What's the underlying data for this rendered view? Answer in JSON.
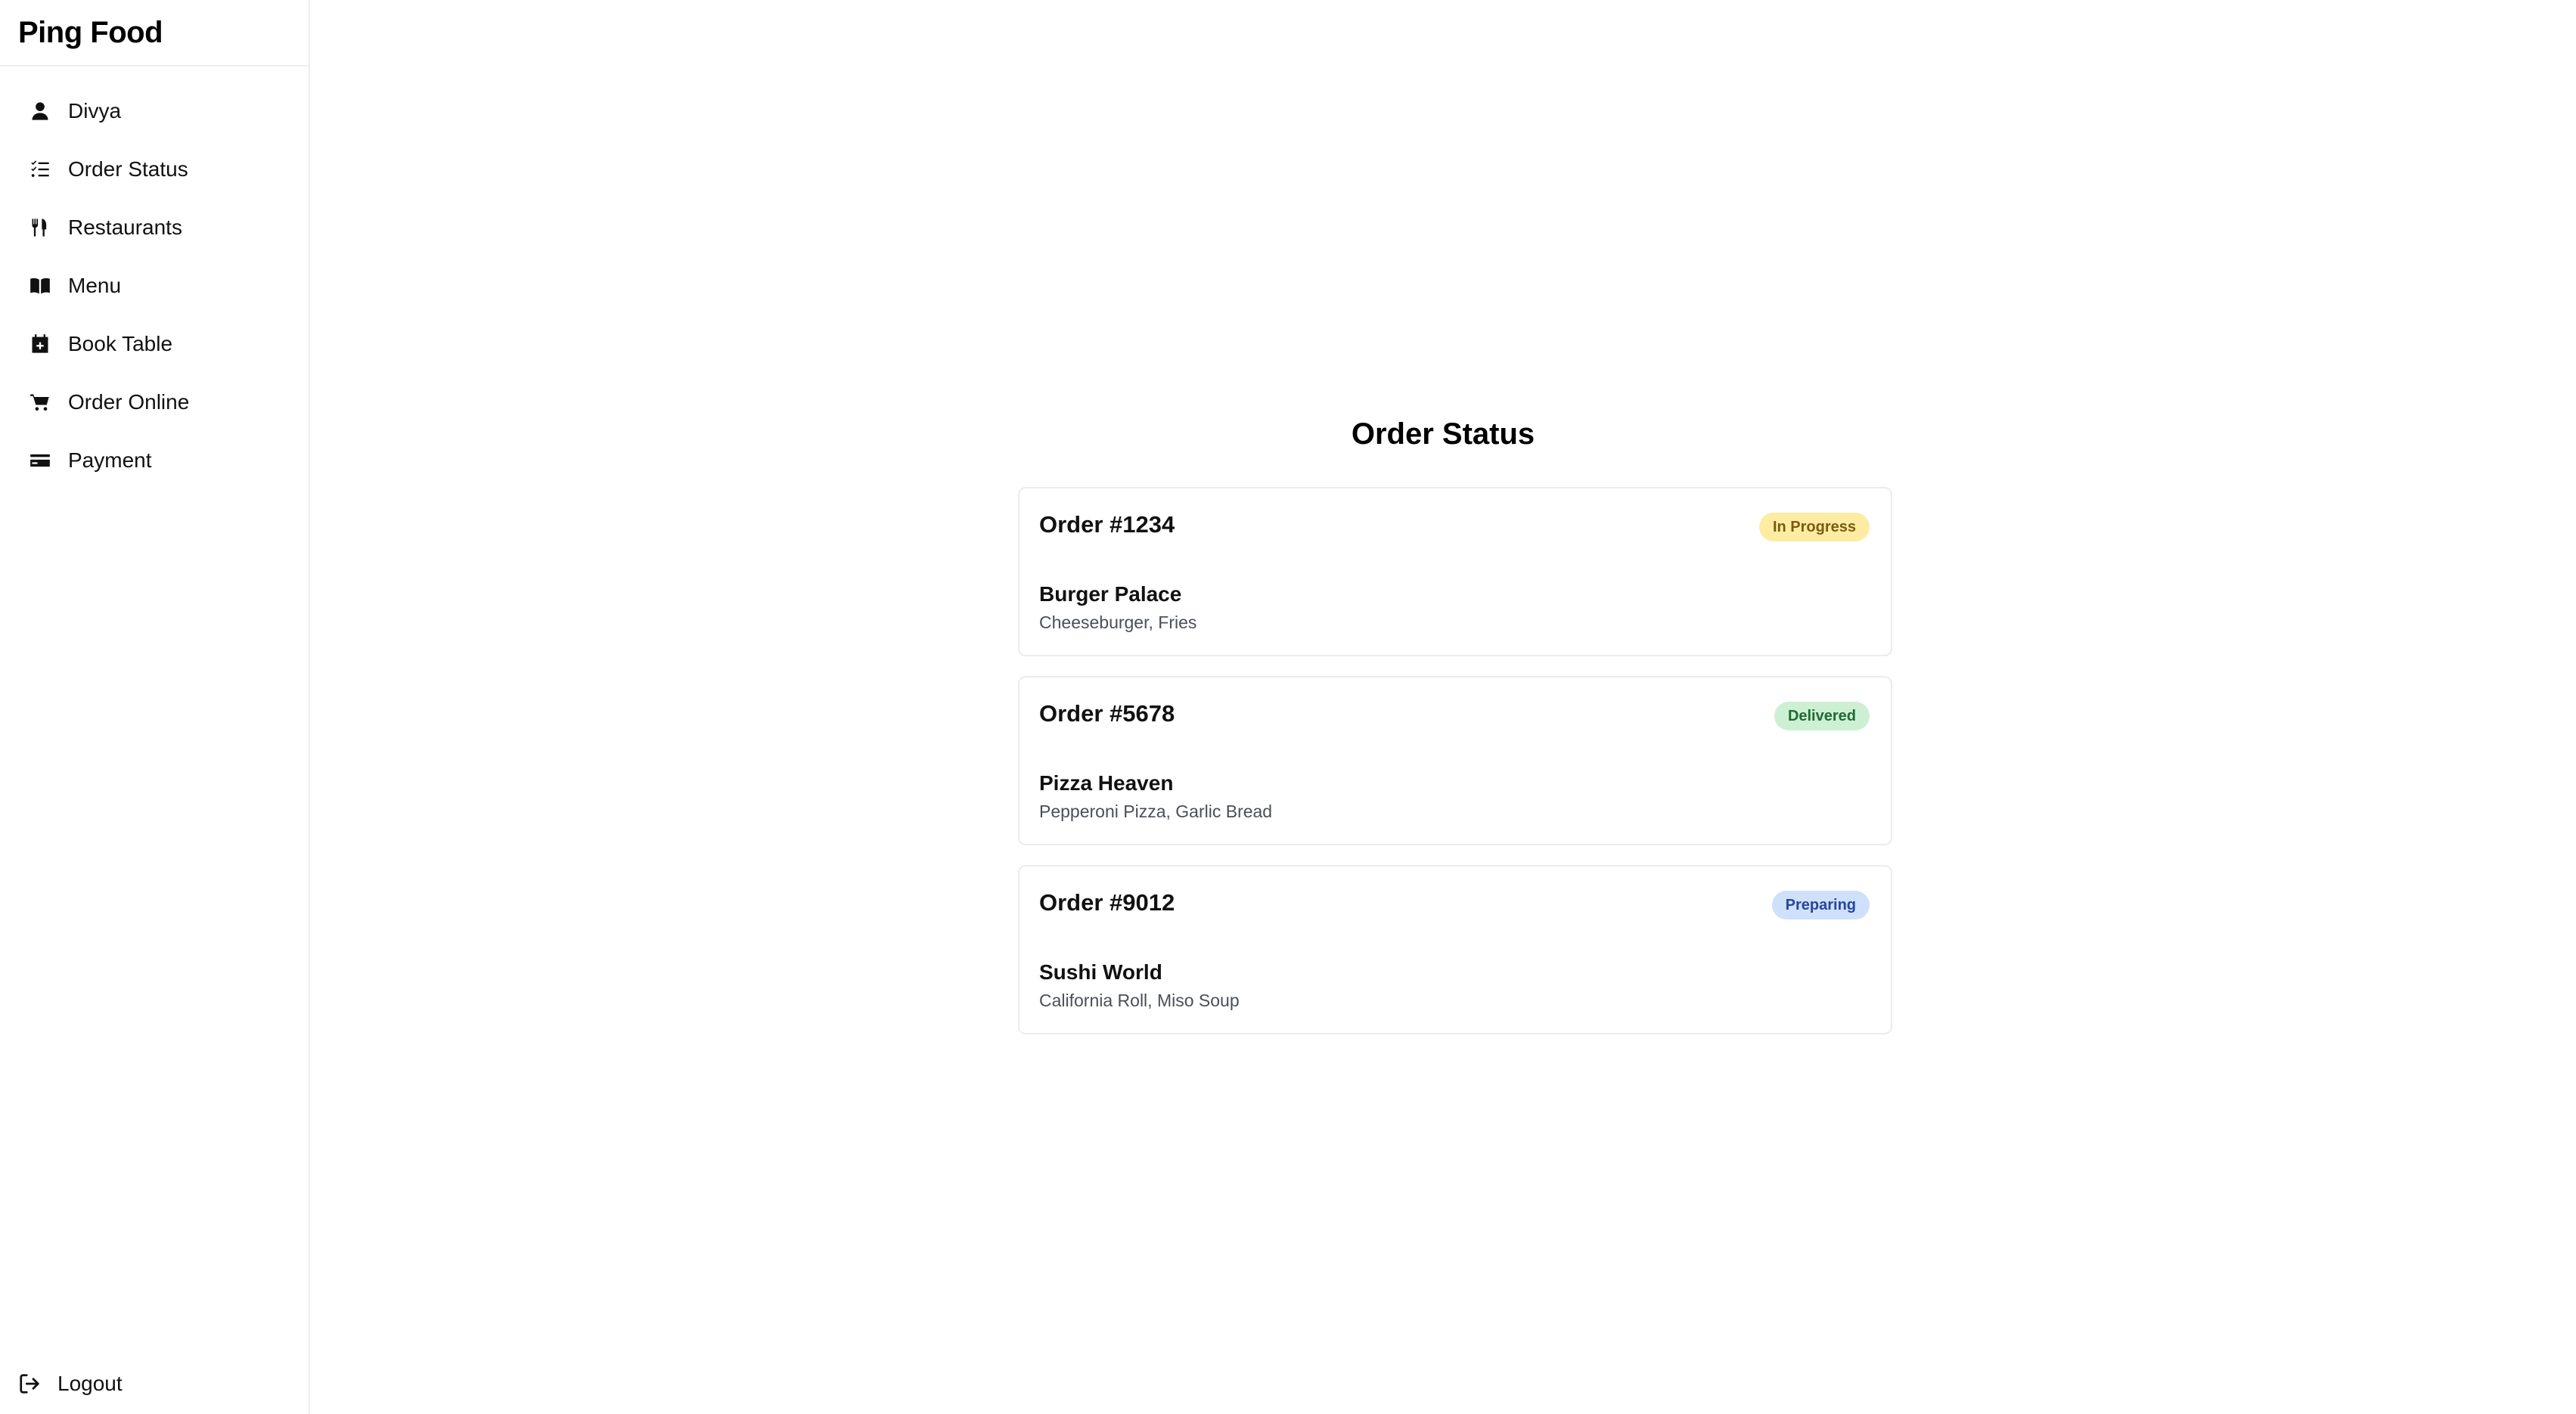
{
  "app": {
    "title": "Ping Food"
  },
  "sidebar": {
    "items": [
      {
        "label": "Divya",
        "icon": "user-icon"
      },
      {
        "label": "Order Status",
        "icon": "list-check-icon"
      },
      {
        "label": "Restaurants",
        "icon": "utensils-icon"
      },
      {
        "label": "Menu",
        "icon": "book-open-icon"
      },
      {
        "label": "Book Table",
        "icon": "calendar-plus-icon"
      },
      {
        "label": "Order Online",
        "icon": "cart-icon"
      },
      {
        "label": "Payment",
        "icon": "credit-card-icon"
      }
    ],
    "logout": {
      "label": "Logout",
      "icon": "logout-icon"
    }
  },
  "main": {
    "title": "Order Status",
    "orders": [
      {
        "id": "Order #1234",
        "status": "In Progress",
        "restaurant": "Burger Palace",
        "items": "Cheeseburger, Fries"
      },
      {
        "id": "Order #5678",
        "status": "Delivered",
        "restaurant": "Pizza Heaven",
        "items": "Pepperoni Pizza, Garlic Bread"
      },
      {
        "id": "Order #9012",
        "status": "Preparing",
        "restaurant": "Sushi World",
        "items": "California Roll, Miso Soup"
      }
    ]
  },
  "colors": {
    "badge_in_progress_bg": "#fdeca2",
    "badge_delivered_bg": "#cdf0d4",
    "badge_preparing_bg": "#cfe0fb"
  }
}
